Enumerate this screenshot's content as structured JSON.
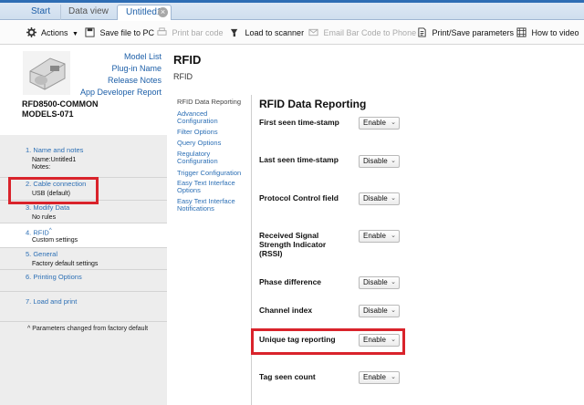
{
  "tabs": {
    "start": "Start",
    "data_view": "Data view",
    "untitled": "Untitled1",
    "close_glyph": "×"
  },
  "toolbar": {
    "actions": "Actions",
    "save": "Save file to PC",
    "print_barcode": "Print bar code",
    "load_scanner": "Load to scanner",
    "email_barcode": "Email Bar Code to Phone",
    "print_save_params": "Print/Save parameters",
    "how_to_video": "How to video"
  },
  "model": {
    "links": [
      "Model List",
      "Plug-in Name",
      "Release Notes",
      "App Developer Report"
    ],
    "name": "RFD8500-COMMON MODELS-071"
  },
  "steps": [
    {
      "title": "1.  Name and notes",
      "sub1": "Name:Untitled1",
      "sub2": "Notes:"
    },
    {
      "title": "2.  Cable connection",
      "sub1": "USB (default)"
    },
    {
      "title": "3.  Modify Data",
      "sub1": "No rules"
    },
    {
      "title": "4.  RFID",
      "mark": "^",
      "sub1": "Custom settings"
    },
    {
      "title": "5.  General",
      "sub1": "Factory default settings"
    },
    {
      "title": "6.  Printing Options"
    },
    {
      "title": "7.  Load and print"
    }
  ],
  "footnote": "^   Parameters changed from factory default",
  "main": {
    "title": "RFID",
    "subtitle": "RFID",
    "subnav": [
      "RFID Data Reporting",
      "Advanced Configuration",
      "Filter Options",
      "Query Options",
      "Regulatory Configuration",
      "Trigger Configuration",
      "Easy Text Interface Options",
      "Easy Text Interface Notifications"
    ],
    "section_title": "RFID Data Reporting",
    "rows": [
      {
        "label": "First seen time-stamp",
        "value": "Enable"
      },
      {
        "label": "Last seen time-stamp",
        "value": "Disable"
      },
      {
        "label": "Protocol Control field",
        "value": "Disable"
      },
      {
        "label": "Received Signal Strength Indicator (RSSI)",
        "value": "Enable"
      },
      {
        "label": "Phase difference",
        "value": "Disable"
      },
      {
        "label": "Channel index",
        "value": "Disable"
      },
      {
        "label": "Unique tag reporting",
        "value": "Enable"
      },
      {
        "label": "Tag seen count",
        "value": "Enable"
      }
    ]
  },
  "colors": {
    "link": "#2c6fb5",
    "highlight": "#d9232b",
    "step_panel": "#ededed"
  }
}
